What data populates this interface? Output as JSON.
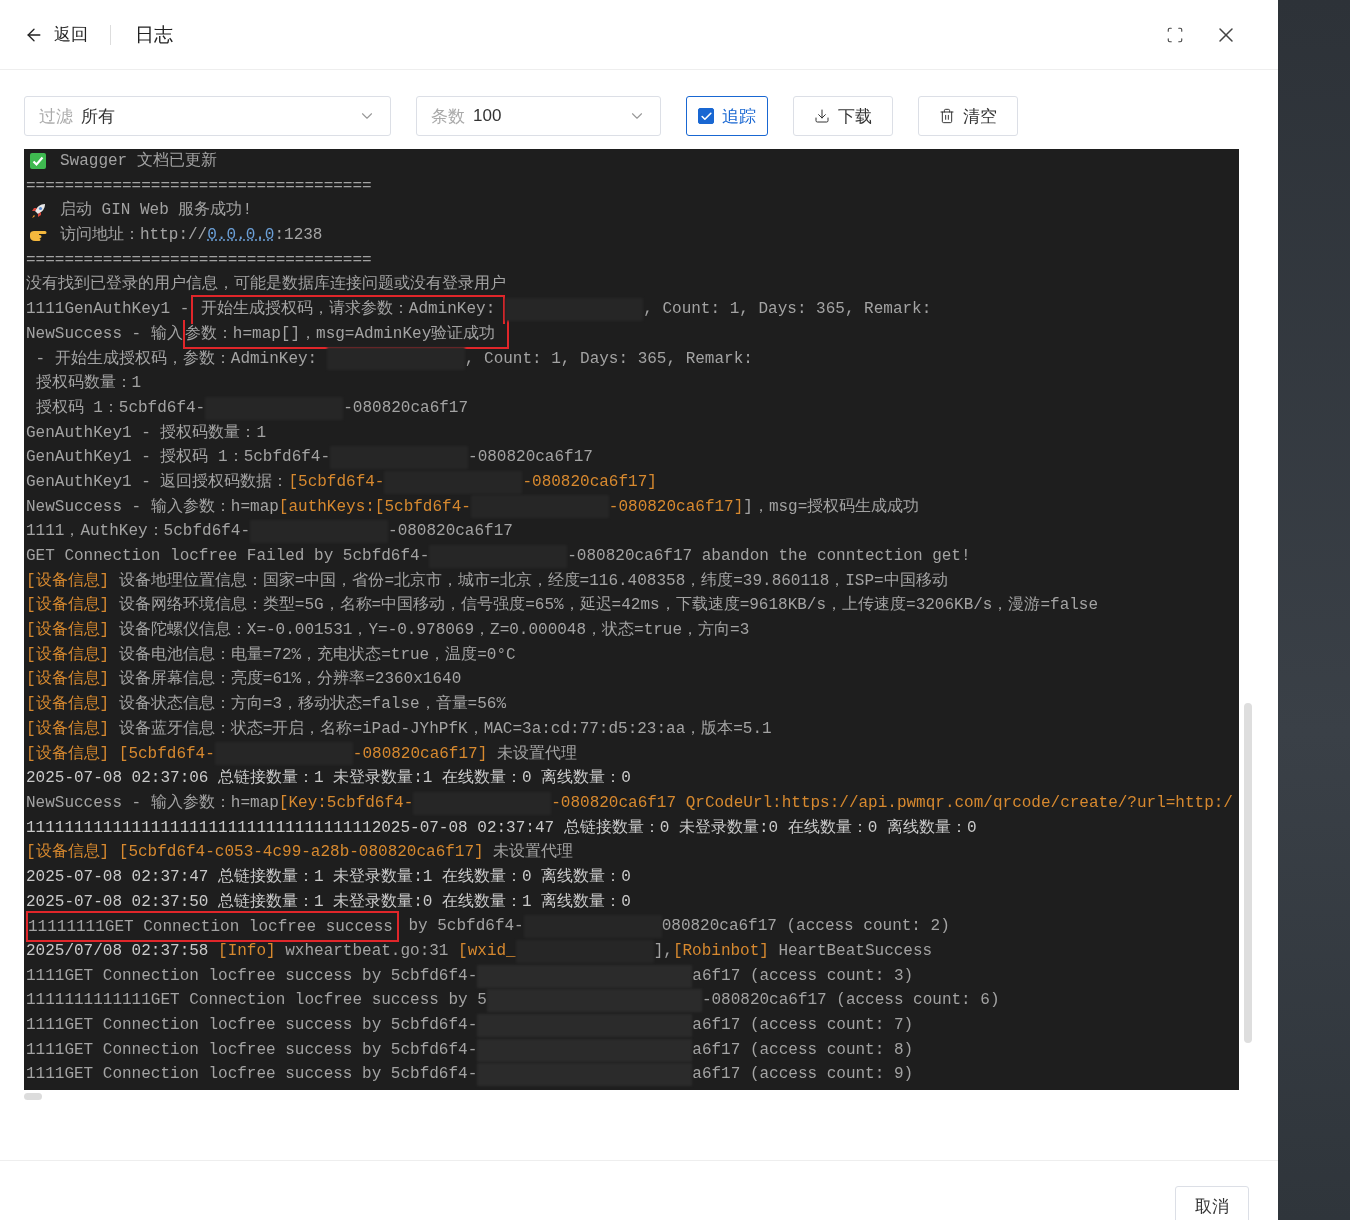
{
  "header": {
    "back": "返回",
    "title": "日志"
  },
  "toolbar": {
    "filter": {
      "label": "过滤",
      "value": "所有"
    },
    "count": {
      "label": "条数",
      "value": "100"
    },
    "follow": {
      "label": "追踪",
      "checked": true
    },
    "buttons": [
      {
        "label": "下载",
        "kind": "download"
      },
      {
        "label": "清空",
        "kind": "clear"
      }
    ]
  },
  "log": {
    "lines": [
      {
        "kind": "success",
        "segments": [
          {
            "kind": "text",
            "text": "Swagger 文档已更新"
          }
        ]
      },
      {
        "kind": "plain",
        "segments": [
          {
            "kind": "text",
            "text": "===================================="
          }
        ]
      },
      {
        "kind": "launch",
        "segments": [
          {
            "kind": "text",
            "text": "启动 GIN Web 服务成功!"
          }
        ]
      },
      {
        "kind": "address",
        "segments": [
          {
            "kind": "text",
            "text": "访问地址：http://"
          },
          {
            "kind": "link",
            "text": "0.0.0.0"
          },
          {
            "kind": "text",
            "text": ":1238"
          }
        ]
      },
      {
        "kind": "plain",
        "segments": [
          {
            "kind": "text",
            "text": "===================================="
          }
        ]
      },
      {
        "kind": "plain",
        "segments": [
          {
            "kind": "text",
            "text": "没有找到已登录的用户信息，可能是数据库连接问题或没有登录用户"
          }
        ]
      },
      {
        "kind": "plain",
        "segments": [
          {
            "kind": "text",
            "text": "1111GenAuthKey1 - "
          },
          {
            "kind": "text",
            "text": "开始生成授权码，请求参数：AdminKey:",
            "boxed": true
          },
          {
            "kind": "redacted"
          },
          {
            "kind": "text",
            "text": ", Count: 1, Days: 365, Remark:"
          }
        ]
      },
      {
        "kind": "plain",
        "segments": [
          {
            "kind": "text",
            "text": "NewSuccess - 输入"
          },
          {
            "kind": "text",
            "text": "参数：h=map[]，msg=AdminKey验证成功",
            "boxed": true
          }
        ]
      },
      {
        "kind": "plain",
        "segments": [
          {
            "kind": "text",
            "text": " - 开始生成授权码，参数：AdminKey: "
          },
          {
            "kind": "redacted"
          },
          {
            "kind": "text",
            "text": ", Count: 1, Days: 365, Remark:"
          }
        ]
      },
      {
        "kind": "plain",
        "segments": [
          {
            "kind": "text",
            "text": " 授权码数量：1"
          }
        ]
      },
      {
        "kind": "plain",
        "segments": [
          {
            "kind": "text",
            "text": " 授权码 1：5cbfd6f4-"
          },
          {
            "kind": "redacted"
          },
          {
            "kind": "text",
            "text": "-080820ca6f17"
          }
        ]
      },
      {
        "kind": "plain",
        "segments": [
          {
            "kind": "text",
            "text": "GenAuthKey1 - 授权码数量：1"
          }
        ]
      },
      {
        "kind": "plain",
        "segments": [
          {
            "kind": "text",
            "text": "GenAuthKey1 - 授权码 1：5cbfd6f4-"
          },
          {
            "kind": "redacted"
          },
          {
            "kind": "text",
            "text": "-080820ca6f17"
          }
        ]
      },
      {
        "kind": "plain",
        "segments": [
          {
            "kind": "text",
            "text": "GenAuthKey1 - 返回授权码数据："
          },
          {
            "kind": "hl",
            "text": "[5cbfd6f4-"
          },
          {
            "kind": "redacted"
          },
          {
            "kind": "hl",
            "text": "-080820ca6f17]"
          }
        ]
      },
      {
        "kind": "plain",
        "segments": [
          {
            "kind": "text",
            "text": "NewSuccess - 输入参数：h=map"
          },
          {
            "kind": "hl",
            "text": "[authKeys:[5cbfd6f4-"
          },
          {
            "kind": "redacted"
          },
          {
            "kind": "hl",
            "text": "-080820ca6f17]"
          },
          {
            "kind": "text",
            "text": "]，msg=授权码生成成功"
          }
        ]
      },
      {
        "kind": "plain",
        "segments": [
          {
            "kind": "text",
            "text": "1111，AuthKey：5cbfd6f4-"
          },
          {
            "kind": "redacted"
          },
          {
            "kind": "text",
            "text": "-080820ca6f17"
          }
        ]
      },
      {
        "kind": "plain",
        "segments": [
          {
            "kind": "text",
            "text": "GET Connection locfree Failed by 5cbfd6f4-"
          },
          {
            "kind": "redacted"
          },
          {
            "kind": "text",
            "text": "-080820ca6f17 abandon the conntection get!"
          }
        ]
      },
      {
        "kind": "plain",
        "segments": [
          {
            "kind": "hl",
            "text": "[设备信息]"
          },
          {
            "kind": "text",
            "text": " 设备地理位置信息：国家=中国，省份=北京市，城市=北京，经度=116.408358，纬度=39.860118，ISP=中国移动"
          }
        ]
      },
      {
        "kind": "plain",
        "segments": [
          {
            "kind": "hl",
            "text": "[设备信息]"
          },
          {
            "kind": "text",
            "text": " 设备网络环境信息：类型=5G，名称=中国移动，信号强度=65%，延迟=42ms，下载速度=9618KB/s，上传速度=3206KB/s，漫游=false"
          }
        ]
      },
      {
        "kind": "plain",
        "segments": [
          {
            "kind": "hl",
            "text": "[设备信息]"
          },
          {
            "kind": "text",
            "text": " 设备陀螺仪信息：X=-0.001531，Y=-0.978069，Z=0.000048，状态=true，方向=3"
          }
        ]
      },
      {
        "kind": "plain",
        "segments": [
          {
            "kind": "hl",
            "text": "[设备信息]"
          },
          {
            "kind": "text",
            "text": " 设备电池信息：电量=72%，充电状态=true，温度=0°C"
          }
        ]
      },
      {
        "kind": "plain",
        "segments": [
          {
            "kind": "hl",
            "text": "[设备信息]"
          },
          {
            "kind": "text",
            "text": " 设备屏幕信息：亮度=61%，分辨率=2360x1640"
          }
        ]
      },
      {
        "kind": "plain",
        "segments": [
          {
            "kind": "hl",
            "text": "[设备信息]"
          },
          {
            "kind": "text",
            "text": " 设备状态信息：方向=3，移动状态=false，音量=56%"
          }
        ]
      },
      {
        "kind": "plain",
        "segments": [
          {
            "kind": "hl",
            "text": "[设备信息]"
          },
          {
            "kind": "text",
            "text": " 设备蓝牙信息：状态=开启，名称=iPad-JYhPfK，MAC=3a:cd:77:d5:23:aa，版本=5.1"
          }
        ]
      },
      {
        "kind": "plain",
        "segments": [
          {
            "kind": "hl",
            "text": "[设备信息] [5cbfd6f4-"
          },
          {
            "kind": "redacted"
          },
          {
            "kind": "hl",
            "text": "-080820ca6f17]"
          },
          {
            "kind": "text",
            "text": " 未设置代理"
          }
        ]
      },
      {
        "kind": "plain",
        "segments": [
          {
            "kind": "bright",
            "text": "2025-07-08 02:37:06 总链接数量：1 未登录数量:1 在线数量：0 离线数量：0"
          }
        ]
      },
      {
        "kind": "plain",
        "segments": [
          {
            "kind": "text",
            "text": "NewSuccess - 输入参数：h=map"
          },
          {
            "kind": "hl",
            "text": "[Key:5cbfd6f4-"
          },
          {
            "kind": "redacted"
          },
          {
            "kind": "hl",
            "text": "-080820ca6f17 QrCodeUrl:https://api.pwmqr.com/qrcode/create/?url=http:/"
          }
        ]
      },
      {
        "kind": "plain",
        "segments": [
          {
            "kind": "bright",
            "text": "1111111111111111111111111111111111112025-07-08 02:37:47 总链接数量：0 未登录数量:0 在线数量：0 离线数量：0"
          }
        ]
      },
      {
        "kind": "plain",
        "segments": [
          {
            "kind": "hl",
            "text": "[设备信息] [5cbfd6f4-c053-4c99-a28b-080820ca6f17]"
          },
          {
            "kind": "text",
            "text": " 未设置代理"
          }
        ]
      },
      {
        "kind": "plain",
        "segments": [
          {
            "kind": "bright",
            "text": "2025-07-08 02:37:47 总链接数量：1 未登录数量:1 在线数量：0 离线数量：0"
          }
        ]
      },
      {
        "kind": "plain",
        "segments": [
          {
            "kind": "bright",
            "text": "2025-07-08 02:37:50 总链接数量：1 未登录数量:0 在线数量：1 离线数量：0"
          }
        ]
      },
      {
        "kind": "plain",
        "segments": [
          {
            "kind": "text",
            "text": "11111111GET Connection locfree success",
            "boxed": true
          },
          {
            "kind": "text",
            "text": " by 5cbfd6f4-"
          },
          {
            "kind": "redacted"
          },
          {
            "kind": "text",
            "text": "080820ca6f17 (access count: 2)"
          }
        ]
      },
      {
        "kind": "plain",
        "segments": [
          {
            "kind": "bright",
            "text": "2025/07/08 02:37:58 "
          },
          {
            "kind": "hl",
            "text": "[Info]"
          },
          {
            "kind": "text",
            "text": " wxheartbeat.go:31 "
          },
          {
            "kind": "hl",
            "text": "[wxid_"
          },
          {
            "kind": "redacted"
          },
          {
            "kind": "text",
            "text": "],"
          },
          {
            "kind": "hl",
            "text": "[Robinbot]"
          },
          {
            "kind": "text",
            "text": " HeartBeatSuccess"
          }
        ]
      },
      {
        "kind": "plain",
        "segments": [
          {
            "kind": "text",
            "text": "1111GET Connection locfree success by 5cbfd6f4-"
          },
          {
            "kind": "blurred"
          },
          {
            "kind": "text",
            "text": "a6f17 (access count: 3)"
          }
        ]
      },
      {
        "kind": "plain",
        "segments": [
          {
            "kind": "text",
            "text": "1111111111111GET Connection locfree success by 5"
          },
          {
            "kind": "blurred"
          },
          {
            "kind": "text",
            "text": "-080820ca6f17 (access count: 6)"
          }
        ]
      },
      {
        "kind": "plain",
        "segments": [
          {
            "kind": "text",
            "text": "1111GET Connection locfree success by 5cbfd6f4-"
          },
          {
            "kind": "blurred"
          },
          {
            "kind": "text",
            "text": "a6f17 (access count: 7)"
          }
        ]
      },
      {
        "kind": "plain",
        "segments": [
          {
            "kind": "text",
            "text": "1111GET Connection locfree success by 5cbfd6f4-"
          },
          {
            "kind": "blurred"
          },
          {
            "kind": "text",
            "text": "a6f17 (access count: 8)"
          }
        ]
      },
      {
        "kind": "plain",
        "segments": [
          {
            "kind": "text",
            "text": "1111GET Connection locfree success by 5cbfd6f4-"
          },
          {
            "kind": "blurred"
          },
          {
            "kind": "text",
            "text": "a6f17 (access count: 9)"
          }
        ]
      }
    ]
  },
  "footer": {
    "cancel": "取消"
  }
}
